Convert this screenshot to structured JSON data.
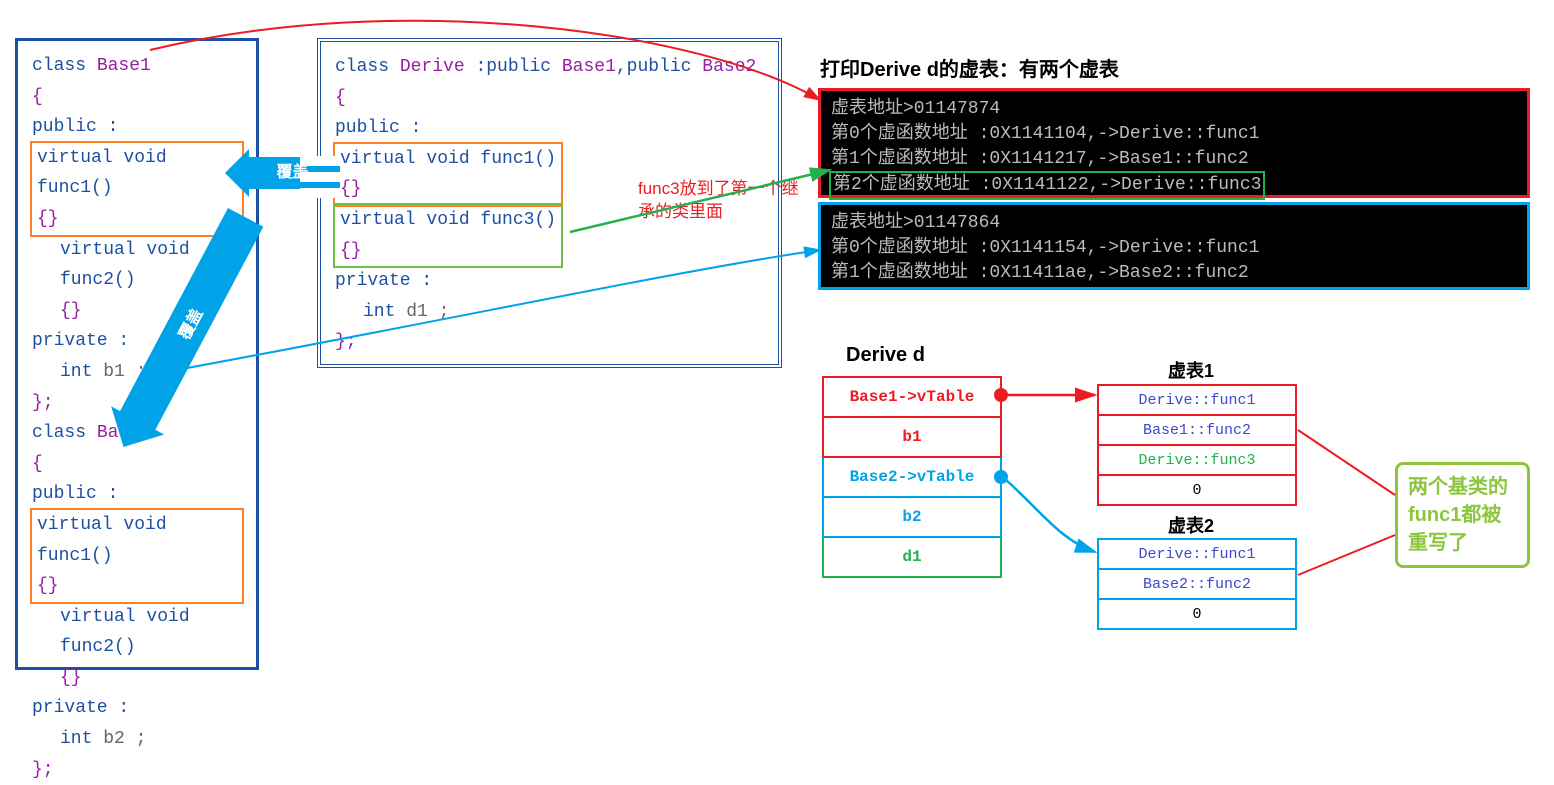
{
  "base1": {
    "decl": "class Base1",
    "public": "public :",
    "f1": "virtual void func1()",
    "b1": "{}",
    "f2": "virtual void func2()",
    "b2": "{}",
    "private": "private :",
    "member": "int b1 ;",
    "end": "};"
  },
  "base2": {
    "decl": "class Base2",
    "public": "public :",
    "f1": "virtual void func1()",
    "b1": "{}",
    "f2": "virtual void func2()",
    "b2": "{}",
    "private": "private :",
    "member": "int b2 ;",
    "end": "};"
  },
  "derive": {
    "decl": "class Derive :public Base1,public Base2",
    "public": "public :",
    "f1": "virtual void func1()",
    "b1": "{}",
    "f3": "virtual void func3()",
    "b3": "{}",
    "private": "private :",
    "member": "int d1 ;",
    "end": "};"
  },
  "labels": {
    "override1": "覆盖",
    "override2": "覆盖",
    "func3note": "func3放到了第一个继承的类里面",
    "consoleTitle": "打印Derive d的虚表：有两个虚表",
    "objTitle": "Derive d",
    "vt1": "虚表1",
    "vt2": "虚表2",
    "callout": "两个基类的func1都被重写了"
  },
  "console1": {
    "l0": "虚表地址>01147874",
    "l1": "第0个虚函数地址 :0X1141104,->Derive::func1",
    "l2": "第1个虚函数地址 :0X1141217,->Base1::func2",
    "l3": "第2个虚函数地址 :0X1141122,->Derive::func3"
  },
  "console2": {
    "l0": "虚表地址>01147864",
    "l1": "第0个虚函数地址 :0X1141154,->Derive::func1",
    "l2": "第1个虚函数地址 :0X11411ae,->Base2::func2"
  },
  "obj": {
    "r1": "Base1->vTable",
    "r2": "b1",
    "r3": "Base2->vTable",
    "r4": "b2",
    "r5": "d1"
  },
  "vt1rows": {
    "r1": "Derive::func1",
    "r2": "Base1::func2",
    "r3": "Derive::func3",
    "r4": "0"
  },
  "vt2rows": {
    "r1": "Derive::func1",
    "r2": "Base2::func2",
    "r3": "0"
  },
  "chart_data": {
    "type": "diagram",
    "description": "C++ multiple-inheritance vtable layout",
    "classes": {
      "Base1": {
        "virtuals": [
          "func1",
          "func2"
        ],
        "members": [
          "int b1"
        ]
      },
      "Base2": {
        "virtuals": [
          "func1",
          "func2"
        ],
        "members": [
          "int b2"
        ]
      },
      "Derive": {
        "bases": [
          "Base1",
          "Base2"
        ],
        "virtuals": [
          "func1",
          "func3"
        ],
        "members": [
          "int d1"
        ]
      }
    },
    "object_layout": [
      "Base1->vTable",
      "b1",
      "Base2->vTable",
      "b2",
      "d1"
    ],
    "vtables": {
      "vtable1_addr": "01147874",
      "vtable1": [
        {
          "idx": 0,
          "addr": "0X1141104",
          "target": "Derive::func1"
        },
        {
          "idx": 1,
          "addr": "0X1141217",
          "target": "Base1::func2"
        },
        {
          "idx": 2,
          "addr": "0X1141122",
          "target": "Derive::func3"
        }
      ],
      "vtable2_addr": "01147864",
      "vtable2": [
        {
          "idx": 0,
          "addr": "0X1141154",
          "target": "Derive::func1"
        },
        {
          "idx": 1,
          "addr": "0X11411ae",
          "target": "Base2::func2"
        }
      ]
    },
    "annotations": [
      "Derive::func1 overrides Base1::func1 and Base2::func1",
      "func3 is placed in the first-inherited base's vtable"
    ]
  }
}
